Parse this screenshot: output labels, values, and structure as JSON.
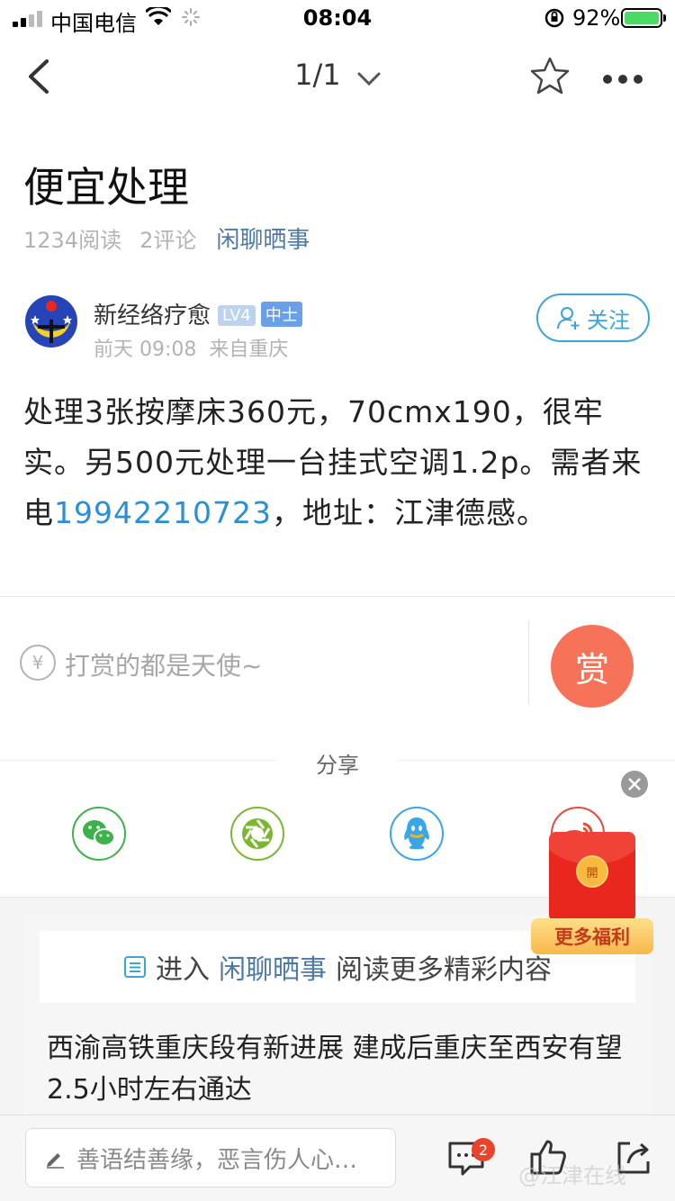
{
  "status_bar": {
    "carrier": "中国电信",
    "time": "08:04",
    "battery_percent": "92%"
  },
  "nav": {
    "pager": "1/1"
  },
  "post": {
    "title": "便宜处理",
    "reads": "1234阅读",
    "comments": "2评论",
    "category": "闲聊晒事",
    "author": {
      "name": "新经络疗愈",
      "level": "LV4",
      "rank": "中士",
      "time": "前天 09:08",
      "from": "来自重庆"
    },
    "follow_label": "关注",
    "body_part1": "处理3张按摩床360元，70cmx190，很牢实。另500元处理一台挂式空调1.2p。需者来电",
    "phone": "19942210723",
    "body_part2": "，地址：江津德感。"
  },
  "reward": {
    "currency_symbol": "¥",
    "text": "打赏的都是天使~",
    "button_label": "赏"
  },
  "share": {
    "label": "分享"
  },
  "red_packet": {
    "coin_label": "開",
    "label": "更多福利"
  },
  "forum_link": {
    "prefix": "进入",
    "forum": "闲聊晒事",
    "suffix": "阅读更多精彩内容"
  },
  "related": {
    "headline": "西渝高铁重庆段有新进展 建成后重庆至西安有望2.5小时左右通达"
  },
  "bottom_bar": {
    "comment_placeholder": "善语结善缘，恶言伤人心…",
    "comment_count": "2"
  },
  "watermark": "@江津在线",
  "colors": {
    "accent_blue": "#3aa6d8",
    "category_blue": "#4e79a7",
    "reward_orange": "#f6735a",
    "red_packet": "#e8281e"
  }
}
